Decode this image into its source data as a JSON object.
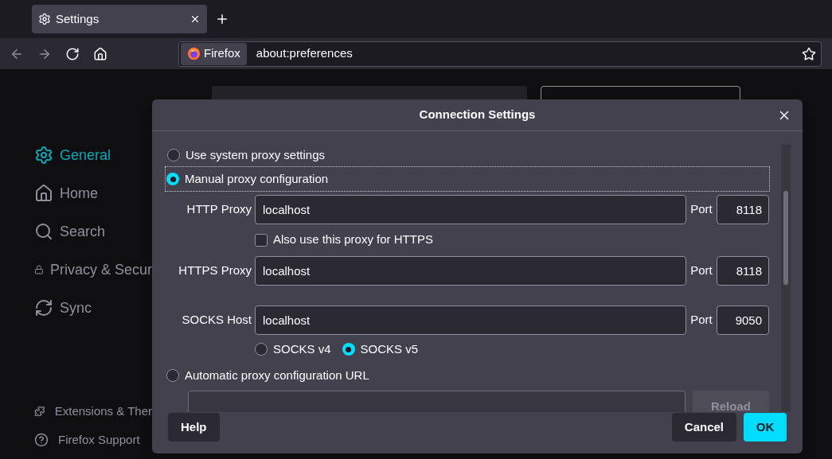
{
  "tabs": [
    {
      "title": "Settings",
      "selected": true
    }
  ],
  "nav_buttons": [
    {
      "kind": "back",
      "disabled": true
    },
    {
      "kind": "forward",
      "disabled": true
    },
    {
      "kind": "reload",
      "disabled": false
    },
    {
      "kind": "home",
      "disabled": false
    }
  ],
  "url_bar": {
    "identity": "Firefox",
    "value": "about:preferences"
  },
  "page": {
    "sidebar": [
      {
        "label": "General",
        "selected": true
      },
      {
        "label": "Home",
        "selected": false
      },
      {
        "label": "Search",
        "selected": false
      },
      {
        "label": "Privacy & Secur",
        "selected": false
      },
      {
        "label": "Sync",
        "selected": false
      }
    ],
    "footer_links": [
      {
        "label": "Extensions & Ther"
      },
      {
        "label": "Firefox Support"
      }
    ]
  },
  "dialog": {
    "title": "Connection Settings",
    "modes": [
      {
        "label": "Use system proxy settings",
        "selected": false,
        "focused": false
      },
      {
        "label": "Manual proxy configuration",
        "selected": true,
        "focused": true
      }
    ],
    "proxies": [
      {
        "label": "HTTP Proxy",
        "value": "localhost",
        "port_label": "Port",
        "port": "8118"
      },
      {
        "label": "HTTPS Proxy",
        "value": "localhost",
        "port_label": "Port",
        "port": "8118"
      },
      {
        "label": "SOCKS Host",
        "value": "localhost",
        "port_label": "Port",
        "port": "9050"
      }
    ],
    "also_https": {
      "label": "Also use this proxy for HTTPS",
      "checked": false
    },
    "socks_versions": [
      {
        "label": "SOCKS v4",
        "selected": false
      },
      {
        "label": "SOCKS v5",
        "selected": true
      }
    ],
    "auto": {
      "label": "Automatic proxy configuration URL",
      "selected": false,
      "reload": "Reload",
      "reload_disabled": true
    },
    "buttons": {
      "help": "Help",
      "cancel": "Cancel",
      "ok": "OK"
    }
  }
}
